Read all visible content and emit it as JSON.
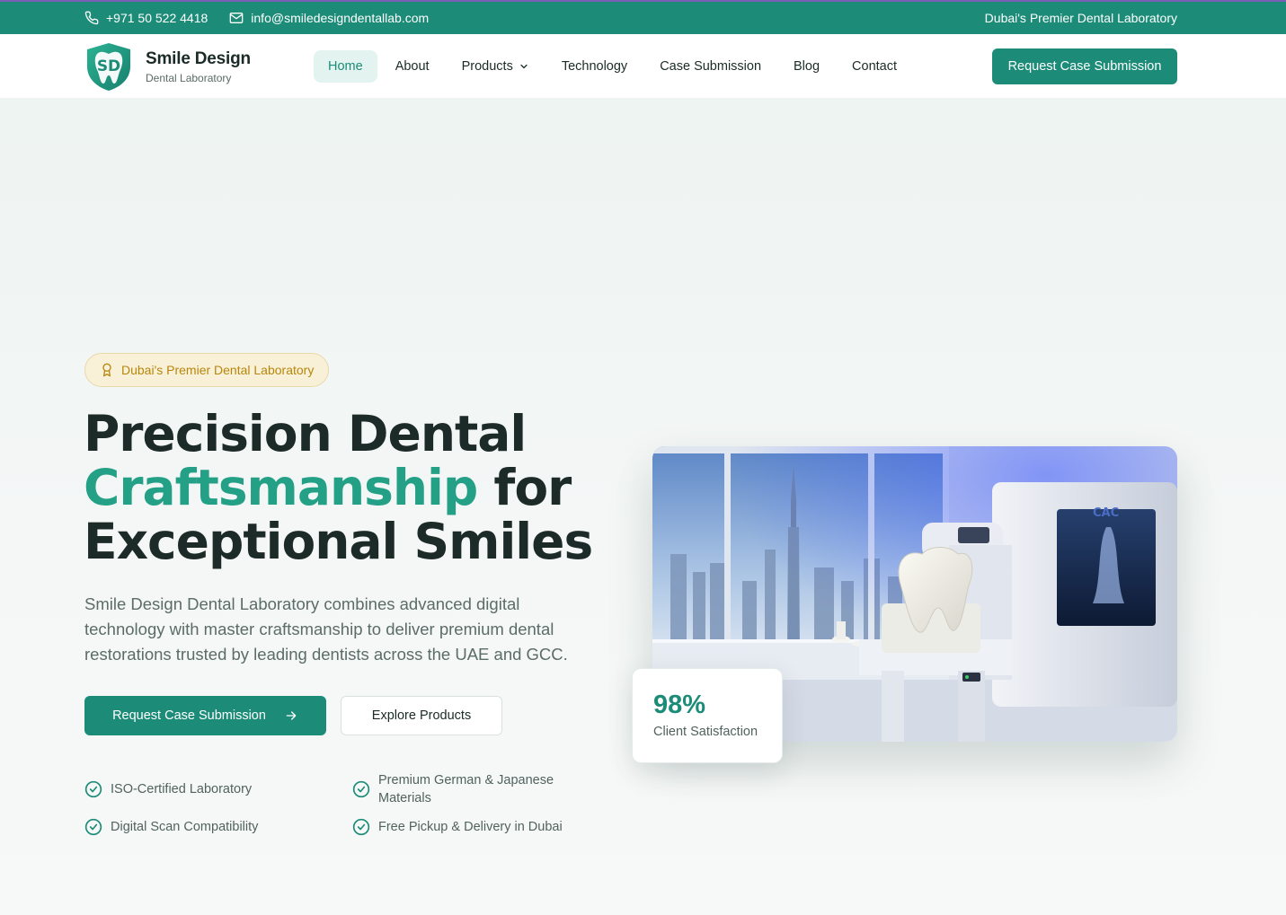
{
  "topbar": {
    "phone": "+971 50 522 4418",
    "email": "info@smiledesigndentallab.com",
    "tagline": "Dubai's Premier Dental Laboratory"
  },
  "brand": {
    "name": "Smile Design",
    "subtitle": "Dental Laboratory",
    "monogram": "SD"
  },
  "nav": {
    "items": [
      {
        "label": "Home",
        "active": true
      },
      {
        "label": "About"
      },
      {
        "label": "Products",
        "dropdown": true
      },
      {
        "label": "Technology"
      },
      {
        "label": "Case Submission"
      },
      {
        "label": "Blog"
      },
      {
        "label": "Contact"
      }
    ],
    "cta": "Request Case Submission"
  },
  "hero": {
    "badge": "Dubai's Premier Dental Laboratory",
    "headline_line1": "Precision Dental",
    "headline_accent": "Craftsmanship",
    "headline_line2_rest": " for",
    "headline_line3": "Exceptional Smiles",
    "lead": "Smile Design Dental Laboratory combines advanced digital technology with master craftsmanship to deliver premium dental restorations trusted by leading dentists across the UAE and GCC.",
    "primary_button": "Request Case Submission",
    "secondary_button": "Explore Products",
    "features": [
      "ISO-Certified Laboratory",
      "Premium German & Japanese Materials",
      "Digital Scan Compatibility",
      "Free Pickup & Delivery in Dubai"
    ],
    "photo_machine_label": "CAC",
    "stat": {
      "value": "98%",
      "label": "Client Satisfaction"
    }
  },
  "colors": {
    "primary": "#1c8c78",
    "accent_text": "#23a085",
    "badge_gold": "#b8860b",
    "topbar_border": "#7a5fb8"
  },
  "icons": [
    "phone-icon",
    "mail-icon",
    "chevron-down-icon",
    "award-icon",
    "arrow-right-icon",
    "check-circle-icon"
  ]
}
